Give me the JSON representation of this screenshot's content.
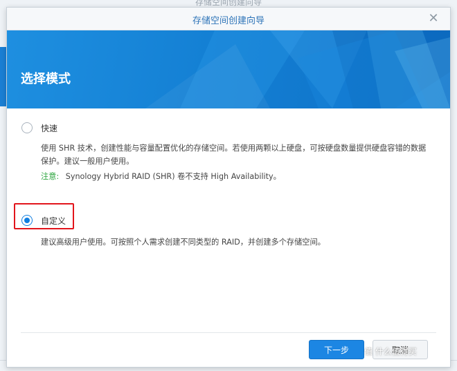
{
  "background": {
    "title_fragment": "存储空间创建向导"
  },
  "dialog": {
    "title": "存储空间创建向导",
    "close_icon": "✕",
    "banner_title": "选择模式"
  },
  "options": {
    "quick": {
      "label": "快速",
      "description": "使用 SHR 技术，创建性能与容量配置优化的存储空间。若使用两颗以上硬盘，可按硬盘数量提供硬盘容错的数据保护。建议一般用户使用。",
      "note_label": "注意:",
      "note_text": "Synology Hybrid RAID (SHR) 卷不支持 High Availability。",
      "selected": false
    },
    "custom": {
      "label": "自定义",
      "description": "建议高级用户使用。可按照个人需求创建不同类型的 RAID，并创建多个存储空间。",
      "selected": true
    }
  },
  "buttons": {
    "next": "下一步",
    "cancel": "取消"
  },
  "watermark": {
    "text": "值 什么值得买"
  },
  "colors": {
    "accent": "#0f7ee0",
    "banner": "#1480d4",
    "highlight": "#e2141b",
    "note": "#2aa43c"
  }
}
